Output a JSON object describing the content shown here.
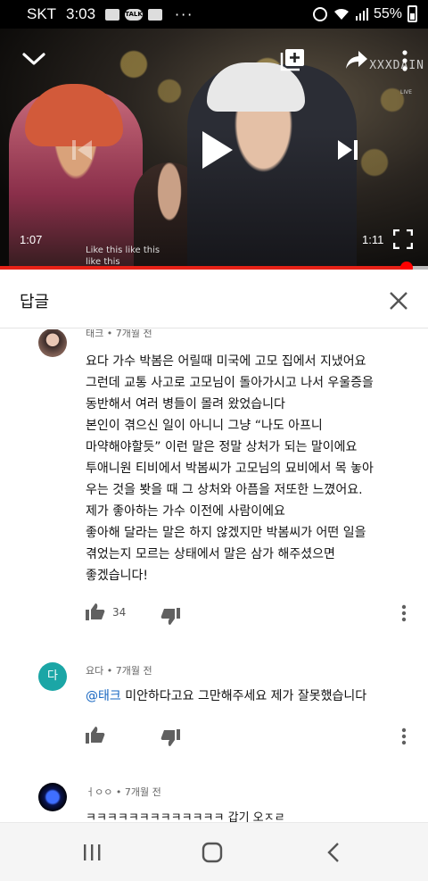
{
  "status_bar": {
    "carrier": "SKT",
    "time": "3:03",
    "notification_icons": [
      "gallery-icon",
      "talk-icon",
      "youtube-icon"
    ],
    "talk_label": "TALK",
    "more_label": "···",
    "battery": "55%"
  },
  "video": {
    "watermark": "XXXDAIN",
    "watermark_sub": "LIVE",
    "subtitle_line1": "Like this like this",
    "subtitle_line2": "like this",
    "current_time": "1:07",
    "duration": "1:11",
    "progress_fraction": 0.95,
    "progress_color": "#e62117"
  },
  "panel": {
    "title": "답글",
    "close_icon": "close-icon"
  },
  "comments": [
    {
      "author_meta": "태크 • 7개월 전",
      "lines": [
        "요다 가수 박봄은 어릴때 미국에 고모 집에서 지냈어요",
        "그런데 교통 사고로 고모님이 돌아가시고 나서 우울증을",
        "동반해서 여러 병들이 몰려 왔었습니다",
        "본인이 겪으신 일이 아니니 그냥 “나도 아프니",
        "마약해야할듯” 이런 말은 정말 상처가 되는 말이에요",
        "투애니원 티비에서 박봄씨가 고모님의 묘비에서 목 놓아",
        "우는 것을 봣을 때 그 상처와 아픔을 저또한 느꼈어요.",
        "제가 좋아하는 가수 이전에 사람이에요",
        "좋아해 달라는 말은 하지 않겠지만 박봄씨가 어떤 일을",
        "겪었는지 모르는 상태에서 말은 삼가 해주셨으면",
        "좋겠습니다!"
      ],
      "likes": "34"
    },
    {
      "avatar_letter": "다",
      "author_meta": "요다 • 7개월 전",
      "mention": "@태크",
      "text": " 미안하다고요 그만해주세요 제가 잘못했습니다"
    },
    {
      "author_meta": "ㅓㅇㅇ • 7개월 전",
      "text": "ㅋㅋㅋㅋㅋㅋㅋㅋㅋㅋㅋㅋㅋ 갑기 오ㅈㄹ"
    }
  ],
  "colors": {
    "accent_red": "#ff0000",
    "mention_blue": "#1565c0",
    "avatar_teal": "#1ba6a6"
  }
}
